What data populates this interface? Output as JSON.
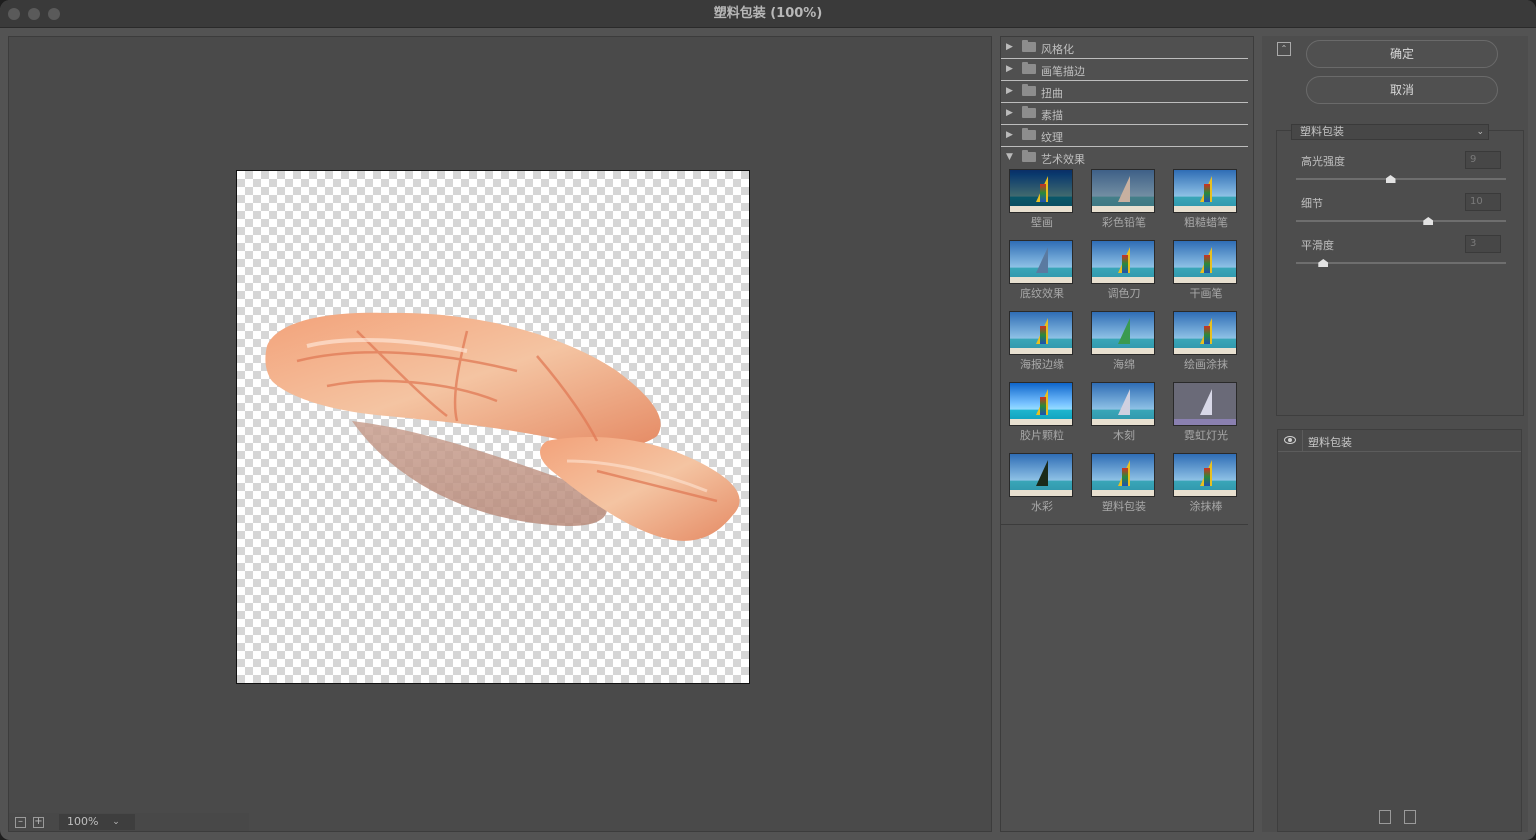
{
  "window": {
    "title": "塑料包装 (100%)"
  },
  "preview": {
    "zoom": "100%"
  },
  "gallery": {
    "categories": [
      {
        "label": "风格化"
      },
      {
        "label": "画笔描边"
      },
      {
        "label": "扭曲"
      },
      {
        "label": "素描"
      },
      {
        "label": "纹理"
      },
      {
        "label": "艺术效果"
      }
    ],
    "filters": [
      {
        "label": "壁画"
      },
      {
        "label": "彩色铅笔"
      },
      {
        "label": "粗糙蜡笔"
      },
      {
        "label": "底纹效果"
      },
      {
        "label": "调色刀"
      },
      {
        "label": "干画笔"
      },
      {
        "label": "海报边缘"
      },
      {
        "label": "海绵"
      },
      {
        "label": "绘画涂抹"
      },
      {
        "label": "胶片颗粒"
      },
      {
        "label": "木刻"
      },
      {
        "label": "霓虹灯光"
      },
      {
        "label": "水彩"
      },
      {
        "label": "塑料包装"
      },
      {
        "label": "涂抹棒"
      }
    ]
  },
  "actions": {
    "ok": "确定",
    "cancel": "取消"
  },
  "settings": {
    "filter_select": "塑料包装",
    "params": [
      {
        "label": "高光强度",
        "value": "9",
        "fraction": 0.45
      },
      {
        "label": "细节",
        "value": "10",
        "fraction": 0.63
      },
      {
        "label": "平滑度",
        "value": "3",
        "fraction": 0.13
      }
    ]
  },
  "layers": [
    {
      "name": "塑料包装"
    }
  ]
}
